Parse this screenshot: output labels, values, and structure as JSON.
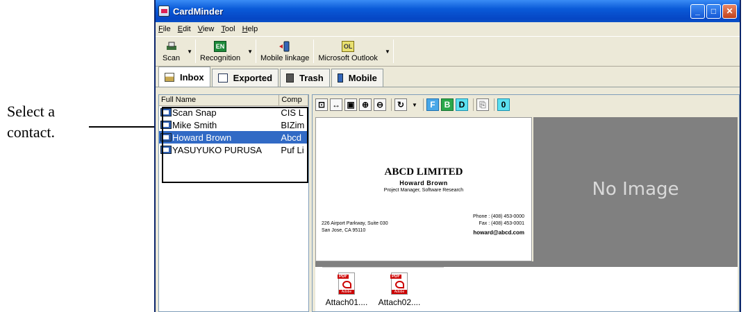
{
  "annotation": {
    "line1": "Select a",
    "line2": "contact."
  },
  "window": {
    "title": "CardMinder"
  },
  "menu": [
    "File",
    "Edit",
    "View",
    "Tool",
    "Help"
  ],
  "toolbar": {
    "scan": "Scan",
    "recognition": "Recognition",
    "recognition_badge": "EN",
    "mobile": "Mobile linkage",
    "outlook": "Microsoft Outlook",
    "outlook_badge": "OL"
  },
  "tabs": [
    "Inbox",
    "Exported",
    "Trash",
    "Mobile"
  ],
  "list": {
    "headers": [
      "Full Name",
      "Comp"
    ],
    "rows": [
      {
        "name": "Scan Snap",
        "company": "CIS L"
      },
      {
        "name": "Mike Smith",
        "company": "BIZim"
      },
      {
        "name": "Howard Brown",
        "company": "Abcd"
      },
      {
        "name": "YASUYUKO PURUSA",
        "company": "Puf Li"
      }
    ]
  },
  "card": {
    "company": "ABCD LIMITED",
    "person": "Howard Brown",
    "job": "Project Manager, Software Research",
    "address1": "226 Airport Parkway, Suite 030",
    "address2": "San Jose, CA 95110",
    "phone": "Phone : (408) 453-0000",
    "fax": "Fax : (408) 453-0001",
    "email": "howard@abcd.com",
    "back_placeholder": "No Image"
  },
  "attachments": [
    {
      "label": "Attach01....",
      "tag": "PDF",
      "brand": "Adobe"
    },
    {
      "label": "Attach02....",
      "tag": "PDF",
      "brand": "Adobe"
    }
  ]
}
